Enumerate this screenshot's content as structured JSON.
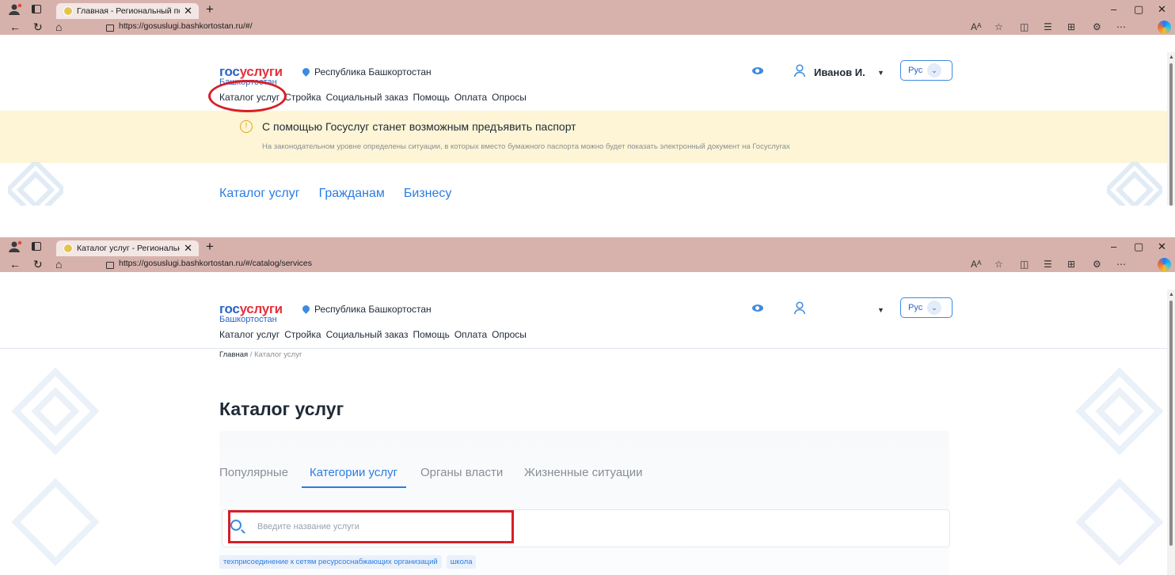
{
  "colors": {
    "accent": "#2b7de3",
    "chrome": "#d7b2ac",
    "annotation": "#d71f27",
    "notice_bg": "#fdf5d5"
  },
  "window": {
    "controls": [
      "–",
      "▢",
      "✕"
    ]
  },
  "toolbar_icons": [
    "read-aloud-icon",
    "favorite-icon",
    "split-screen-icon",
    "favorites-list-icon",
    "collections-icon",
    "extensions-icon",
    "more-icon",
    "copilot-icon"
  ],
  "screen1": {
    "tab_title": "Главная - Региональный портал",
    "url": "https://gosuslugi.bashkortostan.ru/#/",
    "logo": {
      "top_part1": "гос",
      "top_part2": "услуги",
      "bottom": "Башкортостан"
    },
    "region": "Республика Башкортостан",
    "user_name": "Иванов И.",
    "language": "Рус",
    "menu": [
      "Каталог услуг",
      "Стройка",
      "Социальный заказ",
      "Помощь",
      "Оплата",
      "Опросы"
    ],
    "notice": {
      "title": "С помощью Госуслуг станет возможным предъявить паспорт",
      "text": "На законодательном уровне определены ситуации, в которых вместо бумажного паспорта можно будет показать электронный документ на Госуслугах"
    },
    "section_tabs": [
      "Каталог услуг",
      "Гражданам",
      "Бизнесу"
    ]
  },
  "screen2": {
    "tab_title": "Каталог услуг - Региональный портал",
    "url": "https://gosuslugi.bashkortostan.ru/#/catalog/services",
    "logo": {
      "top_part1": "гос",
      "top_part2": "услуги",
      "bottom": "Башкортостан"
    },
    "region": "Республика Башкортостан",
    "user_name": "",
    "language": "Рус",
    "menu": [
      "Каталог услуг",
      "Стройка",
      "Социальный заказ",
      "Помощь",
      "Оплата",
      "Опросы"
    ],
    "breadcrumb": {
      "home": "Главная",
      "separator": " / ",
      "current": "Каталог услуг"
    },
    "page_title": "Каталог услуг",
    "catalog_tabs": [
      "Популярные",
      "Категории услуг",
      "Органы власти",
      "Жизненные ситуации"
    ],
    "active_tab": "Категории услуг",
    "search": {
      "placeholder": "Введите название услуги",
      "value": ""
    },
    "suggestions": [
      "техприсоединение к сетям ресурсоснабжающих организаций",
      "школа"
    ]
  }
}
